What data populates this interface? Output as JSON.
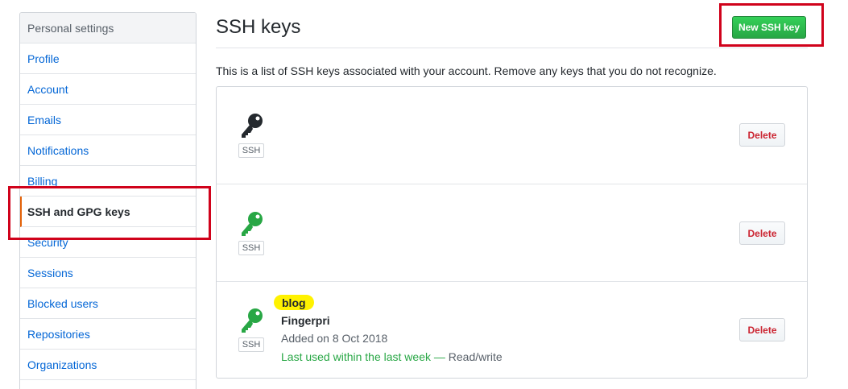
{
  "sidebar": {
    "header": "Personal settings",
    "items": [
      {
        "label": "Profile"
      },
      {
        "label": "Account"
      },
      {
        "label": "Emails"
      },
      {
        "label": "Notifications"
      },
      {
        "label": "Billing"
      },
      {
        "label": "SSH and GPG keys",
        "selected": true
      },
      {
        "label": "Security"
      },
      {
        "label": "Sessions"
      },
      {
        "label": "Blocked users"
      },
      {
        "label": "Repositories"
      },
      {
        "label": "Organizations"
      }
    ]
  },
  "main": {
    "title": "SSH keys",
    "new_key_button": "New SSH key",
    "intro": "This is a list of SSH keys associated with your account. Remove any keys that you do not recognize.",
    "key_type_label": "SSH",
    "delete_label": "Delete",
    "keys": [
      {
        "icon": "key-icon",
        "icon_color": "#24292e",
        "title": "",
        "fingerprint": "",
        "added": "",
        "last_used": ""
      },
      {
        "icon": "key-icon",
        "icon_color": "#28a745",
        "title": "",
        "fingerprint": "",
        "added": "",
        "last_used": ""
      },
      {
        "icon": "key-icon",
        "icon_color": "#28a745",
        "title": "blog",
        "fingerprint": "Fingerpri",
        "added": "Added on 8 Oct 2018",
        "last_used": "Last used within the last week —",
        "access": "Read/write"
      }
    ]
  },
  "colors": {
    "accent": "#0366d6",
    "success": "#28a745",
    "danger": "#cb2431",
    "annotation": "#d0021b",
    "highlight": "#fff200"
  }
}
